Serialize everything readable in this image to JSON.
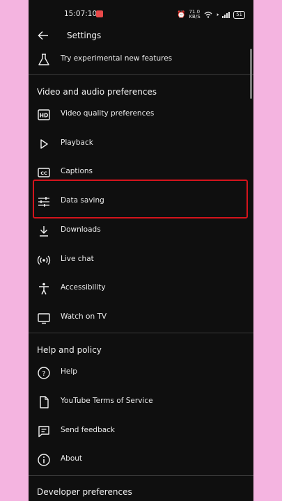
{
  "status": {
    "time": "15:07:10",
    "net_speed_top": "71.0",
    "net_speed_bottom": "KB/S",
    "battery": "51"
  },
  "header": {
    "title": "Settings"
  },
  "top_items": [
    {
      "label": "Try experimental new features",
      "icon": "flask-icon"
    }
  ],
  "sections": {
    "video": {
      "title": "Video and audio preferences",
      "items": [
        {
          "label": "Video quality preferences",
          "icon": "hd-icon"
        },
        {
          "label": "Playback",
          "icon": "play-icon"
        },
        {
          "label": "Captions",
          "icon": "captions-icon"
        },
        {
          "label": "Data saving",
          "icon": "sliders-icon"
        },
        {
          "label": "Downloads",
          "icon": "download-icon"
        },
        {
          "label": "Live chat",
          "icon": "live-chat-icon"
        },
        {
          "label": "Accessibility",
          "icon": "accessibility-icon"
        },
        {
          "label": "Watch on TV",
          "icon": "tv-icon"
        }
      ]
    },
    "help": {
      "title": "Help and policy",
      "items": [
        {
          "label": "Help",
          "icon": "help-icon"
        },
        {
          "label": "YouTube Terms of Service",
          "icon": "document-icon"
        },
        {
          "label": "Send feedback",
          "icon": "feedback-icon"
        },
        {
          "label": "About",
          "icon": "info-icon"
        }
      ]
    },
    "developer": {
      "title": "Developer preferences"
    }
  },
  "colors": {
    "background": "#0f0f0f",
    "outer": "#f4b4e0",
    "highlight": "#d4141c",
    "text": "#f1f1f1"
  }
}
